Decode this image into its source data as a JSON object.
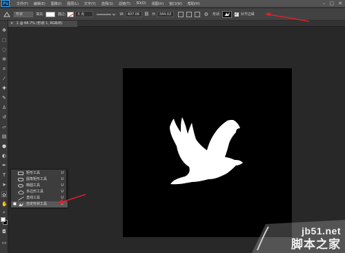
{
  "app": {
    "logo": "Ps"
  },
  "menu": {
    "items": [
      "文件(F)",
      "编辑(E)",
      "图像(I)",
      "图层(L)",
      "文字(Y)",
      "选择(S)",
      "滤镜(T)",
      "3D(D)",
      "视图(V)",
      "窗口(W)",
      "帮助(H)"
    ],
    "window_controls": [
      "–",
      "▢",
      "✕"
    ]
  },
  "options": {
    "mode_label": "形状",
    "fill_label": "填充:",
    "stroke_label": "描边:",
    "stroke_width": "3 点",
    "w_label": "W:",
    "w_value": "407.06",
    "link_icon": "link-icon",
    "h_label": "H:",
    "h_value": "344.02",
    "shape_label": "形状:",
    "align_edges_label": "对齐边缘",
    "align_edges_checked": "✓"
  },
  "document": {
    "tab_title": "1 @ 66.7% (形状 1, RGB/8)",
    "tab_close": "×"
  },
  "flyout": {
    "items": [
      {
        "label": "矩形工具",
        "key": "U",
        "mark": ""
      },
      {
        "label": "圆角矩形工具",
        "key": "U",
        "mark": ""
      },
      {
        "label": "椭圆工具",
        "key": "U",
        "mark": ""
      },
      {
        "label": "多边形工具",
        "key": "U",
        "mark": ""
      },
      {
        "label": "直线工具",
        "key": "U",
        "mark": ""
      },
      {
        "label": "自定形状工具",
        "key": "U",
        "mark": "■"
      }
    ]
  },
  "colors": {
    "accent_arrow": "#e0202a",
    "canvas": "#000000",
    "foreground": "#ffffff",
    "background": "#000000"
  },
  "watermark": {
    "site": "jb51.net",
    "cn": "脚本之家"
  }
}
